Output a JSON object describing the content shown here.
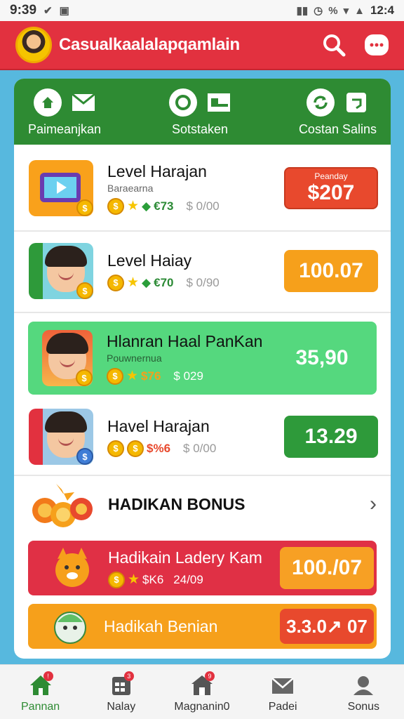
{
  "status_bar": {
    "time": "9:39",
    "clock": "12:4",
    "percent": "%"
  },
  "header": {
    "title": "Casualkaalalapqamlain"
  },
  "categories": [
    {
      "label": "Paimeanjkan"
    },
    {
      "label": "Sotstaken"
    },
    {
      "label": "Costan Salins"
    }
  ],
  "items": [
    {
      "title": "Level Harajan",
      "subtitle": "Baraearna",
      "stat_a": "€73",
      "stat_b": "$ 0/00",
      "price_label": "Peanday",
      "price": "$207",
      "price_color": "#e8492d"
    },
    {
      "title": "Level Haiay",
      "subtitle": "",
      "stat_a": "€70",
      "stat_b": "$ 0/90",
      "price_label": "",
      "price": "100.07",
      "price_color": "#f6a01b"
    },
    {
      "title": "Hlanran Haal PanKan",
      "subtitle": "Pouwnernua",
      "stat_a": "$76",
      "stat_b": "$ 029",
      "price_label": "",
      "price": "35,90",
      "price_color": "#4dd87a"
    },
    {
      "title": "Havel Harajan",
      "subtitle": "",
      "stat_a": "$%6",
      "stat_b": "$ 0/00",
      "price_label": "",
      "price": "13.29",
      "price_color": "#2e9a3a"
    }
  ],
  "bonus": {
    "title": "HADIKAN BONUS"
  },
  "promos": [
    {
      "title": "Hadikain Ladery Kam",
      "stat_a": "$K6",
      "stat_b": "24/09",
      "price": "100./07",
      "color": "#e03045",
      "price_color": "#f7a024"
    },
    {
      "title": "Hadikah Benian",
      "price": "3.3.0↗ 07",
      "color": "#f6a01b",
      "price_color": "#e8492d"
    }
  ],
  "nav": [
    {
      "label": "Pannan",
      "icon": "home-icon",
      "active": true
    },
    {
      "label": "Nalay",
      "icon": "calendar-icon"
    },
    {
      "label": "Magnanin0",
      "icon": "store-icon"
    },
    {
      "label": "Padei",
      "icon": "mail-icon"
    },
    {
      "label": "Sonus",
      "icon": "profile-icon"
    }
  ],
  "colors": {
    "header": "#e2313f",
    "category_bar": "#2e8b33",
    "background": "#57b8de"
  }
}
